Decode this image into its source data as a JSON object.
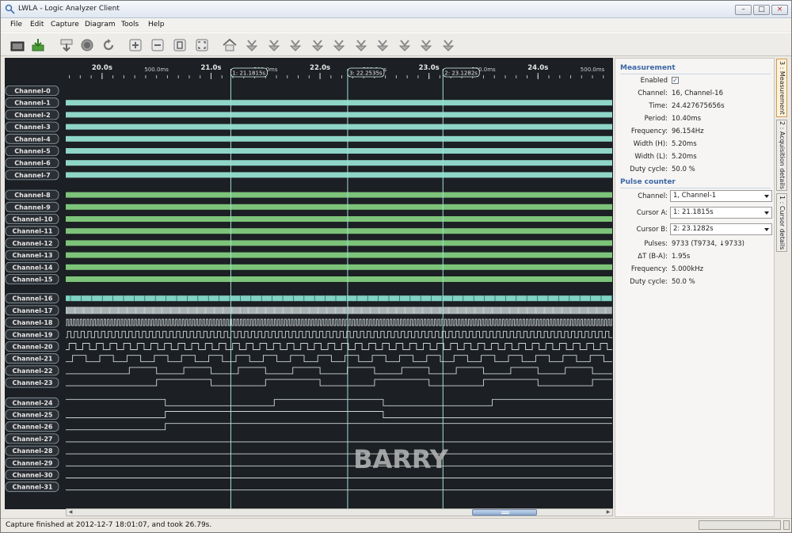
{
  "window": {
    "title": "LWLA - Logic Analyzer Client"
  },
  "menu": [
    "File",
    "Edit",
    "Capture",
    "Diagram",
    "Tools",
    "Help"
  ],
  "toolbar": [
    "open-file",
    "download",
    "export",
    "record",
    "refresh",
    "zoom-in",
    "zoom-out",
    "zoom-fit",
    "zoom-full",
    "home",
    "trigger-1",
    "trigger-2",
    "trigger-3",
    "trigger-4",
    "trigger-5",
    "trigger-6",
    "trigger-7",
    "trigger-8",
    "trigger-9",
    "trigger-10"
  ],
  "ruler": {
    "major": [
      "20.0s",
      "21.0s",
      "22.0s",
      "23.0s",
      "24.0s"
    ],
    "minor": [
      "500.0ms",
      "500.0ms",
      "500.0ms",
      "500.0ms",
      "500.0ms"
    ]
  },
  "cursors": [
    {
      "label": "1: 21.1815s",
      "time": 21.1815
    },
    {
      "label": "3: 22.2535s",
      "time": 22.2535
    },
    {
      "label": "2: 23.1282s",
      "time": 23.1282
    }
  ],
  "channels": [
    "Channel-0",
    "Channel-1",
    "Channel-2",
    "Channel-3",
    "Channel-4",
    "Channel-5",
    "Channel-6",
    "Channel-7",
    "Channel-8",
    "Channel-9",
    "Channel-10",
    "Channel-11",
    "Channel-12",
    "Channel-13",
    "Channel-14",
    "Channel-15",
    "Channel-16",
    "Channel-17",
    "Channel-18",
    "Channel-19",
    "Channel-20",
    "Channel-21",
    "Channel-22",
    "Channel-23",
    "Channel-24",
    "Channel-25",
    "Channel-26",
    "Channel-27",
    "Channel-28",
    "Channel-29",
    "Channel-30",
    "Channel-31"
  ],
  "watermark": "BARRY",
  "colors": {
    "wave_cyan": "#8fd6c8",
    "wave_green": "#7dc47a",
    "bus_cyan": "#7fd2c4",
    "background": "#1c1f23",
    "cursor": "#9fe0d6"
  },
  "measurement": {
    "title": "Measurement",
    "enabled_label": "Enabled",
    "enabled": true,
    "rows": [
      {
        "label": "Channel:",
        "value": "16, Channel-16"
      },
      {
        "label": "Time:",
        "value": "24.427675656s"
      },
      {
        "label": "Period:",
        "value": "10.40ms"
      },
      {
        "label": "Frequency:",
        "value": "96.154Hz"
      },
      {
        "label": "Width (H):",
        "value": "5.20ms"
      },
      {
        "label": "Width (L):",
        "value": "5.20ms"
      },
      {
        "label": "Duty cycle:",
        "value": "50.0 %"
      }
    ]
  },
  "pulse_counter": {
    "title": "Pulse counter",
    "channel_label": "Channel:",
    "channel_value": "1, Channel-1",
    "cursor_a_label": "Cursor A:",
    "cursor_a_value": "1: 21.1815s",
    "cursor_b_label": "Cursor B:",
    "cursor_b_value": "2: 23.1282s",
    "rows": [
      {
        "label": "Pulses:",
        "value": "9733 (T9734, ↓9733)"
      },
      {
        "label": "ΔT (B-A):",
        "value": "1.95s"
      },
      {
        "label": "Frequency:",
        "value": "5.000kHz"
      },
      {
        "label": "Duty cycle:",
        "value": "50.0 %"
      }
    ]
  },
  "tabs": [
    "3 : Measurement",
    "2 : Acquisition details",
    "1 : Cursor details"
  ],
  "status": {
    "text": "Capture finished at 2012-12-7 18:01:07, and took 26.79s."
  }
}
